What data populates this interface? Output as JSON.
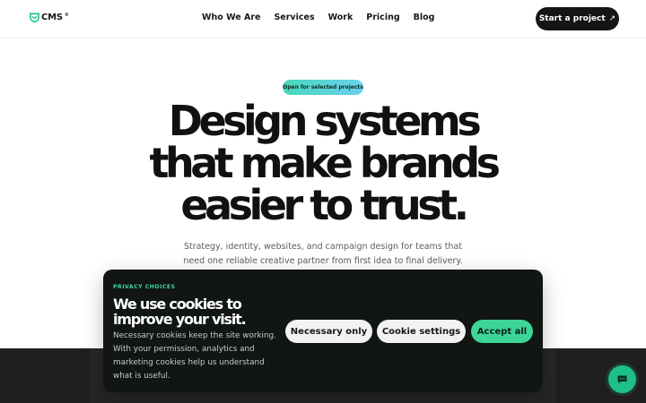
{
  "header": {
    "logo_text": "CMS",
    "logo_reg": "®",
    "nav": [
      "Who We Are",
      "Services",
      "Work",
      "Pricing",
      "Blog"
    ],
    "cta_label": "Start a project",
    "cta_icon": "arrow-up-right-icon"
  },
  "hero": {
    "badge": "Open for selected projects",
    "title_lines": [
      "Design systems",
      "that make brands",
      "easier to trust."
    ],
    "subtitle": "Strategy, identity, websites, and campaign design for teams that need one reliable creative partner from first idea to final delivery."
  },
  "cookie": {
    "eyebrow": "PRIVACY CHOICES",
    "title": "We use cookies to improve your visit.",
    "body": "Necessary cookies keep the site working. With your permission, analytics and marketing cookies help us understand what is useful.",
    "buttons": {
      "necessary": "Necessary only",
      "settings": "Cookie settings",
      "accept": "Accept all"
    }
  },
  "chat": {
    "icon": "chat-bubble-icon"
  },
  "colors": {
    "accent": "#3dd598",
    "dark": "#111613",
    "text": "#171717"
  }
}
